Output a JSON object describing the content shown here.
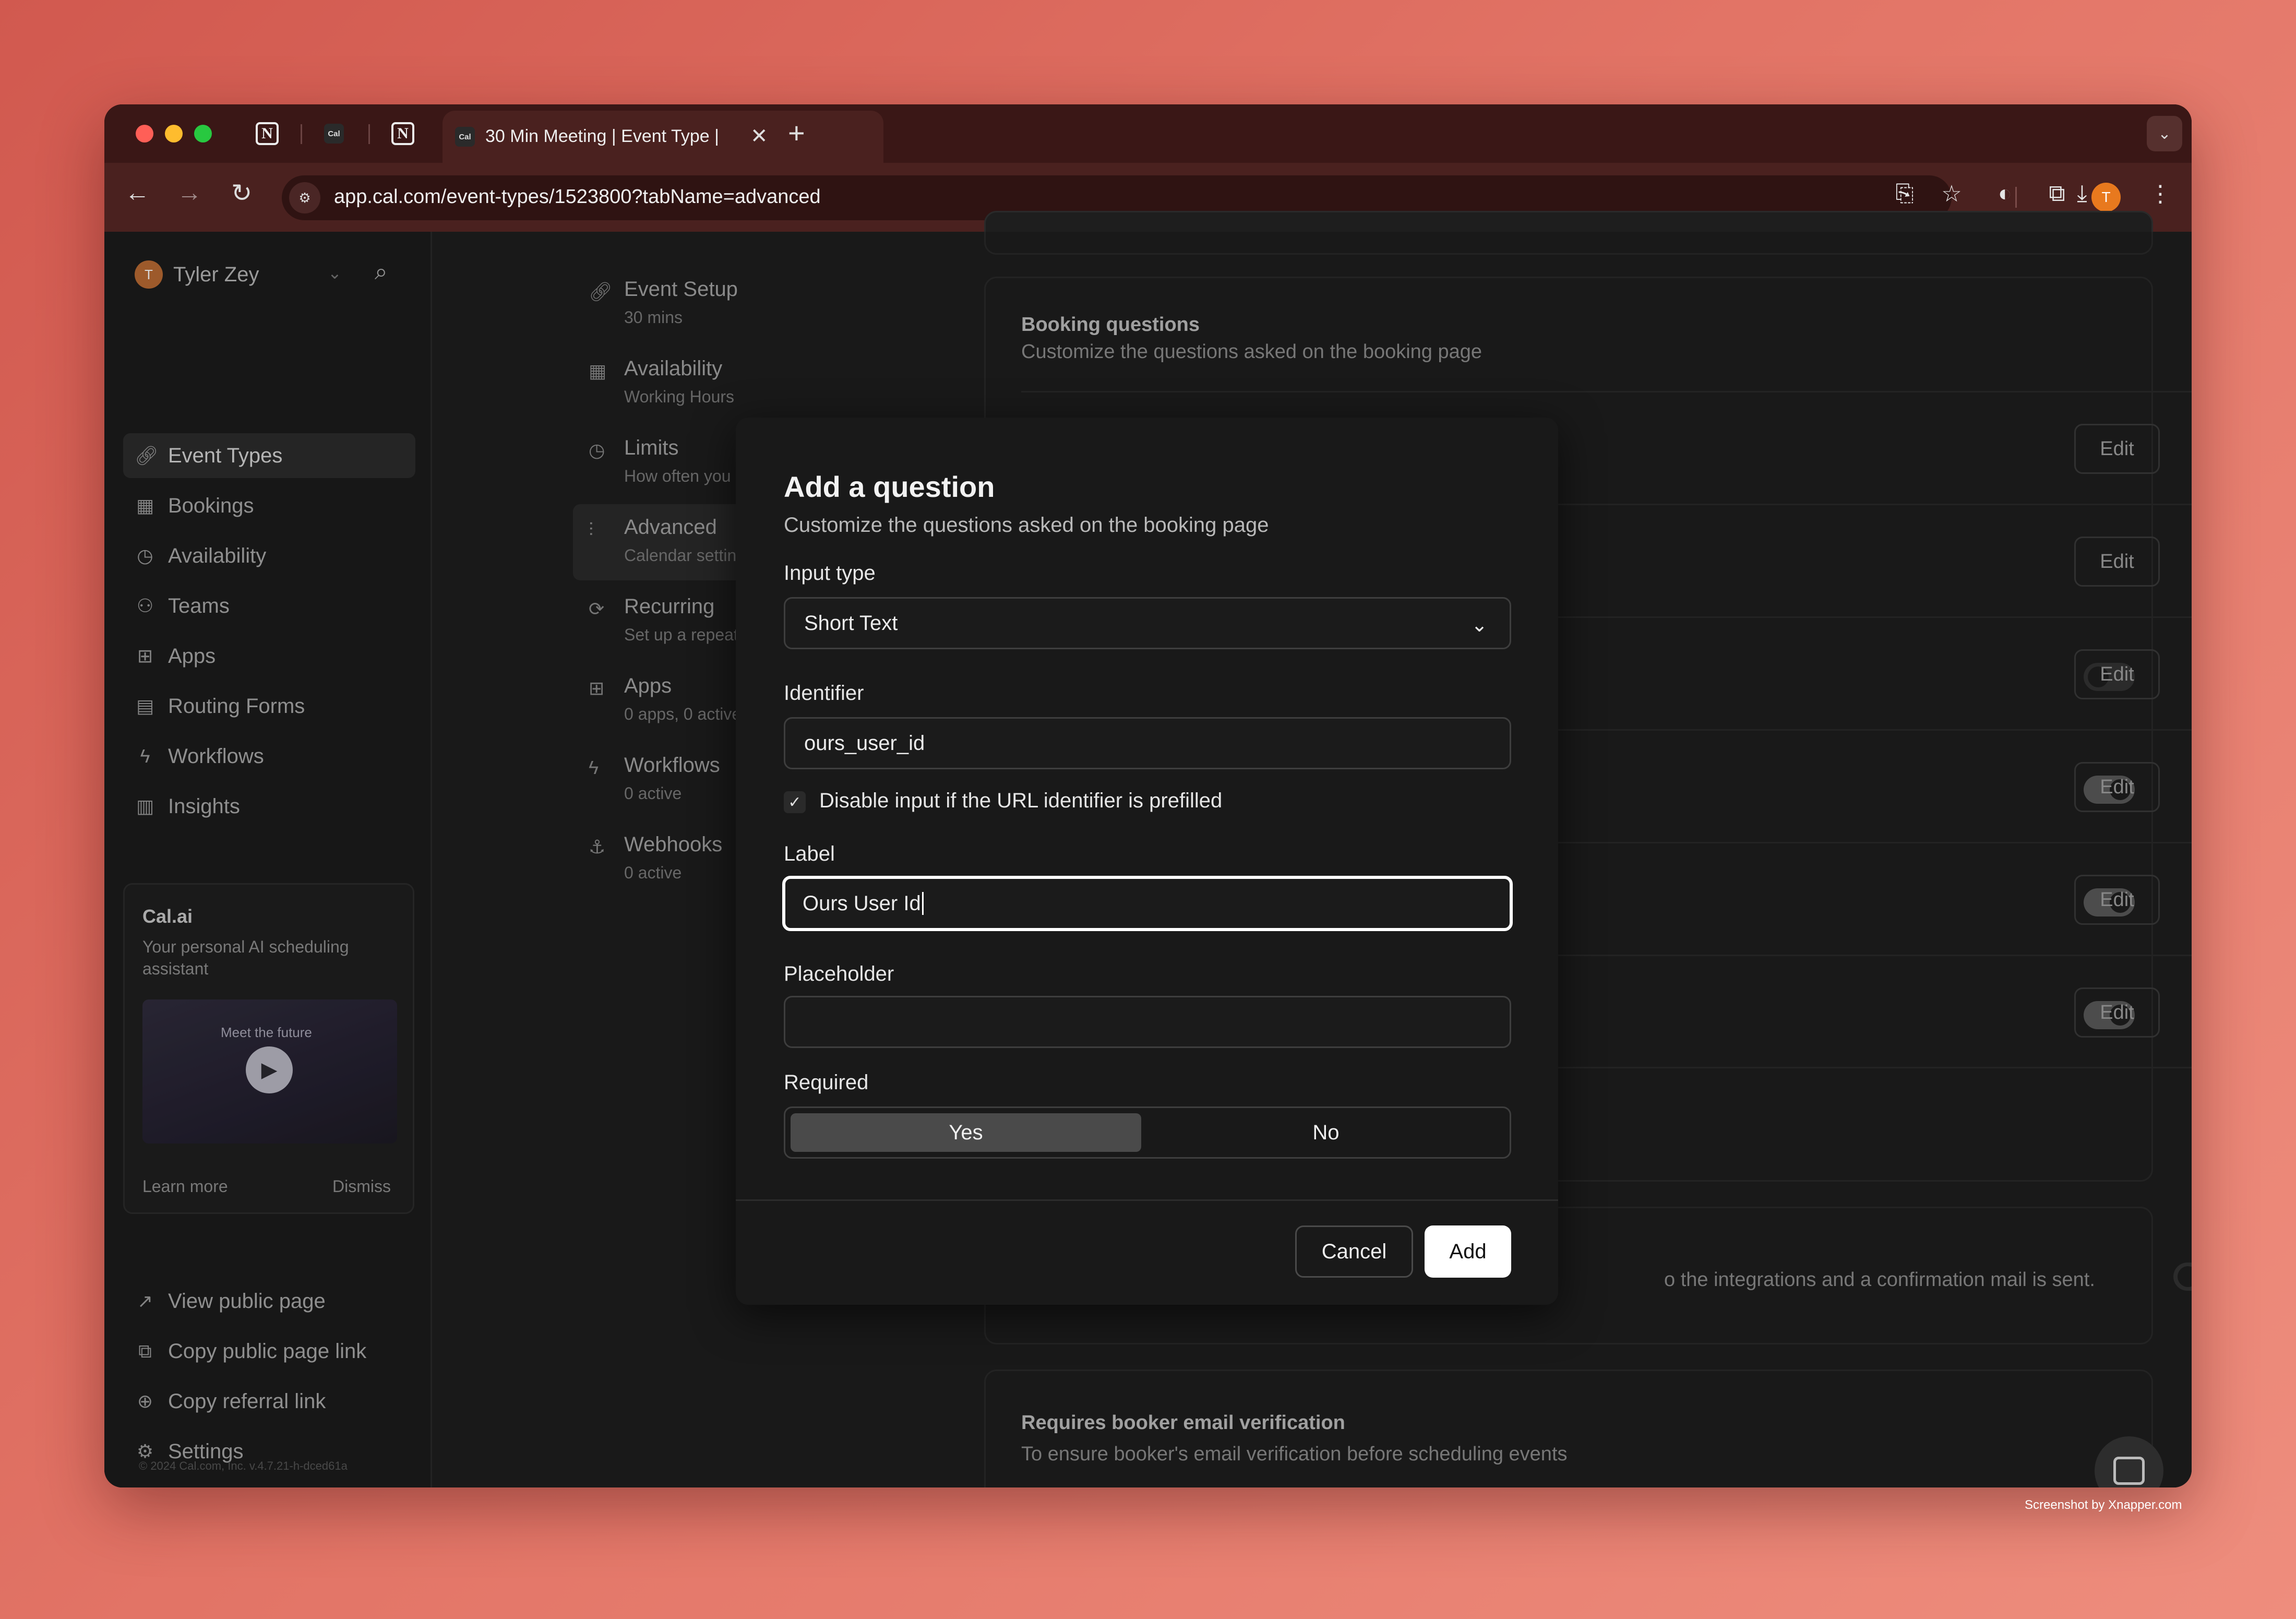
{
  "browser": {
    "active_tab_title": "30 Min Meeting | Event Type |",
    "url": "app.cal.com/event-types/1523800?tabName=advanced",
    "profile_initial": "T",
    "cal_favicon_text": "Cal"
  },
  "sidebar": {
    "user_name": "Tyler Zey",
    "user_initial": "T",
    "items": [
      {
        "label": "Event Types",
        "icon": "link-icon"
      },
      {
        "label": "Bookings",
        "icon": "calendar-icon"
      },
      {
        "label": "Availability",
        "icon": "clock-icon"
      },
      {
        "label": "Teams",
        "icon": "users-icon"
      },
      {
        "label": "Apps",
        "icon": "grid-icon"
      },
      {
        "label": "Routing Forms",
        "icon": "document-icon"
      },
      {
        "label": "Workflows",
        "icon": "zap-icon"
      },
      {
        "label": "Insights",
        "icon": "bar-chart-icon"
      }
    ],
    "promo": {
      "title": "Cal.ai",
      "description": "Your personal AI scheduling assistant",
      "video_text": "Meet the future",
      "learn_more": "Learn more",
      "dismiss": "Dismiss"
    },
    "bottom": [
      {
        "label": "View public page",
        "icon": "external-link-icon"
      },
      {
        "label": "Copy public page link",
        "icon": "copy-icon"
      },
      {
        "label": "Copy referral link",
        "icon": "gift-icon"
      },
      {
        "label": "Settings",
        "icon": "gear-icon"
      }
    ],
    "copyright": "© 2024 Cal.com, Inc. v.4.7.21-h-dced61a"
  },
  "event_nav": [
    {
      "title": "Event Setup",
      "sub": "30 mins",
      "icon": "link-icon"
    },
    {
      "title": "Availability",
      "sub": "Working Hours",
      "icon": "calendar-icon"
    },
    {
      "title": "Limits",
      "sub": "How often you can be booked",
      "icon": "clock-icon"
    },
    {
      "title": "Advanced",
      "sub": "Calendar settings & more...",
      "icon": "sliders-icon"
    },
    {
      "title": "Recurring",
      "sub": "Set up a repeating schedule",
      "icon": "repeat-icon"
    },
    {
      "title": "Apps",
      "sub": "0 apps, 0 active",
      "icon": "grid-icon"
    },
    {
      "title": "Workflows",
      "sub": "0 active",
      "icon": "zap-icon"
    },
    {
      "title": "Webhooks",
      "sub": "0 active",
      "icon": "webhook-icon"
    }
  ],
  "booking_questions": {
    "title": "Booking questions",
    "description": "Customize the questions asked on the booking page",
    "edit_label": "Edit"
  },
  "confirmation_text": "o the integrations and a confirmation mail is sent.",
  "email_verification": {
    "title": "Requires booker email verification",
    "description": "To ensure booker's email verification before scheduling events"
  },
  "modal": {
    "title": "Add a question",
    "subtitle": "Customize the questions asked on the booking page",
    "input_type_label": "Input type",
    "input_type_value": "Short Text",
    "identifier_label": "Identifier",
    "identifier_value": "ours_user_id",
    "disable_checkbox_label": "Disable input if the URL identifier is prefilled",
    "label_label": "Label",
    "label_value": "Ours User Id",
    "placeholder_label": "Placeholder",
    "placeholder_value": "",
    "required_label": "Required",
    "required_yes": "Yes",
    "required_no": "No",
    "cancel": "Cancel",
    "add": "Add"
  },
  "credit": "Screenshot by Xnapper.com"
}
